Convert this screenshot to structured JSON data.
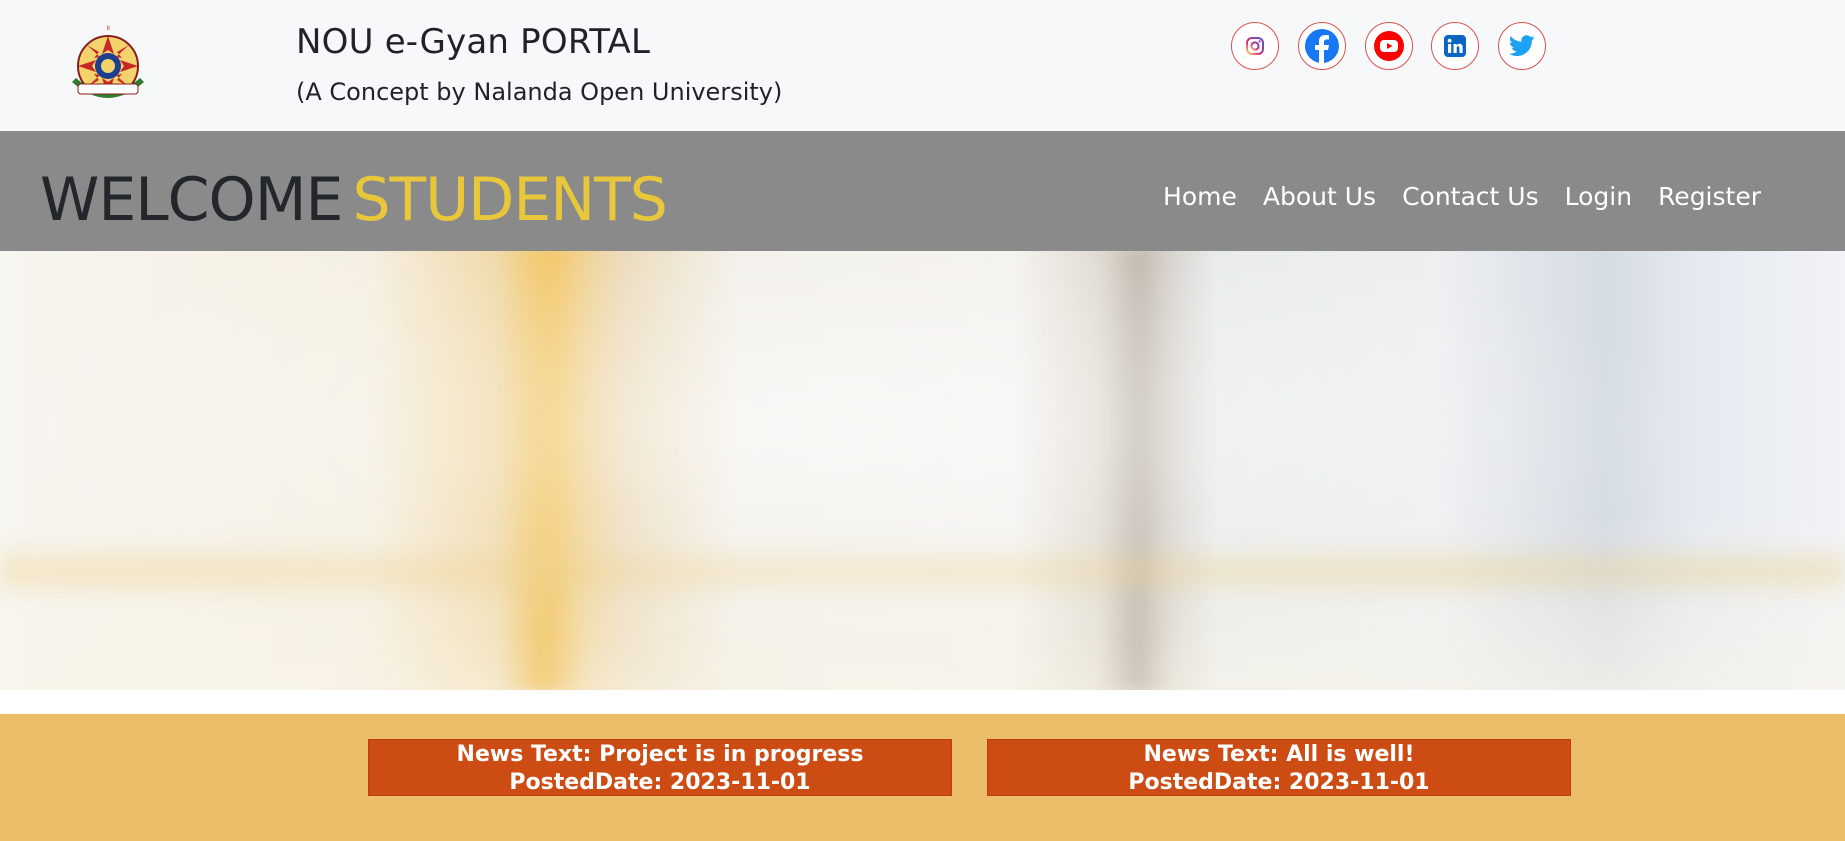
{
  "header": {
    "title": "NOU e-Gyan PORTAL",
    "subtitle": "(A Concept by Nalanda Open University)",
    "logo": "university-seal-logo",
    "social": [
      {
        "name": "instagram-icon",
        "color": "#c13584"
      },
      {
        "name": "facebook-icon",
        "color": "#1877f2"
      },
      {
        "name": "youtube-icon",
        "color": "#ff0000"
      },
      {
        "name": "linkedin-icon",
        "color": "#0a66c2"
      },
      {
        "name": "twitter-icon",
        "color": "#1da1f2"
      }
    ]
  },
  "navbar": {
    "welcome_word": "WELCOME",
    "students_word": "STUDENTS",
    "links": [
      "Home",
      "About Us",
      "Contact Us",
      "Login",
      "Register"
    ]
  },
  "news": [
    {
      "text": "News Text: Project is in progress",
      "date": "PostedDate: 2023-11-01"
    },
    {
      "text": "News Text: All is well!",
      "date": "PostedDate: 2023-11-01"
    }
  ],
  "colors": {
    "topbar_bg": "#f7f8fa",
    "navbar_bg": "#8a8a8a",
    "accent_yellow": "#e8c73a",
    "news_strip_bg": "#ecbe6a",
    "news_card_bg": "#cc4c14"
  }
}
